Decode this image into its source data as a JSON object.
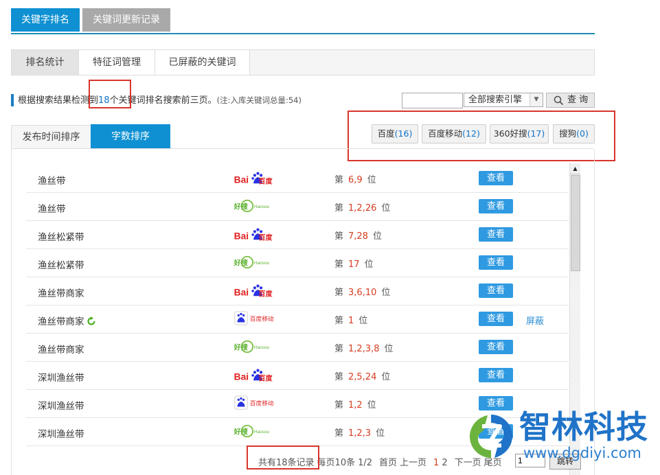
{
  "top_tabs": {
    "keyword_rank": "关键字排名",
    "update_log": "关键词更新记录"
  },
  "sub_tabs": {
    "stats": "排名统计",
    "features": "特征词管理",
    "blocked": "已屏蔽的关键词"
  },
  "summary": {
    "prefix": "根据搜索结果检测到",
    "count": "18",
    "suffix": "个关键词排名搜索前三页。",
    "note": "(注:入库关键词总量:54)"
  },
  "search": {
    "input_value": "",
    "engine_select": "全部搜索引擎",
    "button": "查 询"
  },
  "engine_filters": [
    {
      "name": "百度",
      "count": "(16)"
    },
    {
      "name": "百度移动",
      "count": "(12)"
    },
    {
      "name": "360好搜",
      "count": "(17)"
    },
    {
      "name": "搜狗",
      "count": "(0)"
    }
  ],
  "sort_tabs": {
    "by_time": "发布时间排序",
    "by_length": "字数排序"
  },
  "rank_label": {
    "prefix": "第",
    "suffix": "位"
  },
  "view_label": "查看",
  "block_label": "屏蔽",
  "rows": [
    {
      "keyword": "渔丝带",
      "engine": "baidu",
      "ranks": "6,9"
    },
    {
      "keyword": "渔丝带",
      "engine": "haosou",
      "ranks": "1,2,26"
    },
    {
      "keyword": "渔丝松紧带",
      "engine": "baidu",
      "ranks": "7,28"
    },
    {
      "keyword": "渔丝松紧带",
      "engine": "haosou",
      "ranks": "17"
    },
    {
      "keyword": "渔丝带商家",
      "engine": "baidu",
      "ranks": "3,6,10"
    },
    {
      "keyword": "渔丝带商家",
      "engine": "baidu-mobile",
      "ranks": "1"
    },
    {
      "keyword": "渔丝带商家",
      "engine": "haosou",
      "ranks": "1,2,3,8"
    },
    {
      "keyword": "深圳渔丝带",
      "engine": "baidu",
      "ranks": "2,5,24"
    },
    {
      "keyword": "深圳渔丝带",
      "engine": "baidu-mobile",
      "ranks": "1,2"
    },
    {
      "keyword": "深圳渔丝带",
      "engine": "haosou",
      "ranks": "1,2,3"
    }
  ],
  "logos": {
    "baidu_a": "Bai",
    "baidu_b": "百度",
    "haosou_cn": "好搜",
    "haosou_en": "Haosou",
    "bdm": "百度移动"
  },
  "pager": {
    "total": "共有18条记录",
    "per_page": "每页10条",
    "page_of": "1/2",
    "first": "首页",
    "prev": "上一页",
    "p1": "1",
    "p2": "2",
    "next": "下一页",
    "last": "尾页",
    "input_value": "1",
    "go": "跳转"
  },
  "watermark": {
    "name": "智林科技",
    "url": "www.dgdiyi.com"
  },
  "colors": {
    "primary_blue": "#0e90d2",
    "rank_red": "#d53c1e",
    "view_button": "#2f9ae1",
    "highlight_box": "#d9342b"
  }
}
